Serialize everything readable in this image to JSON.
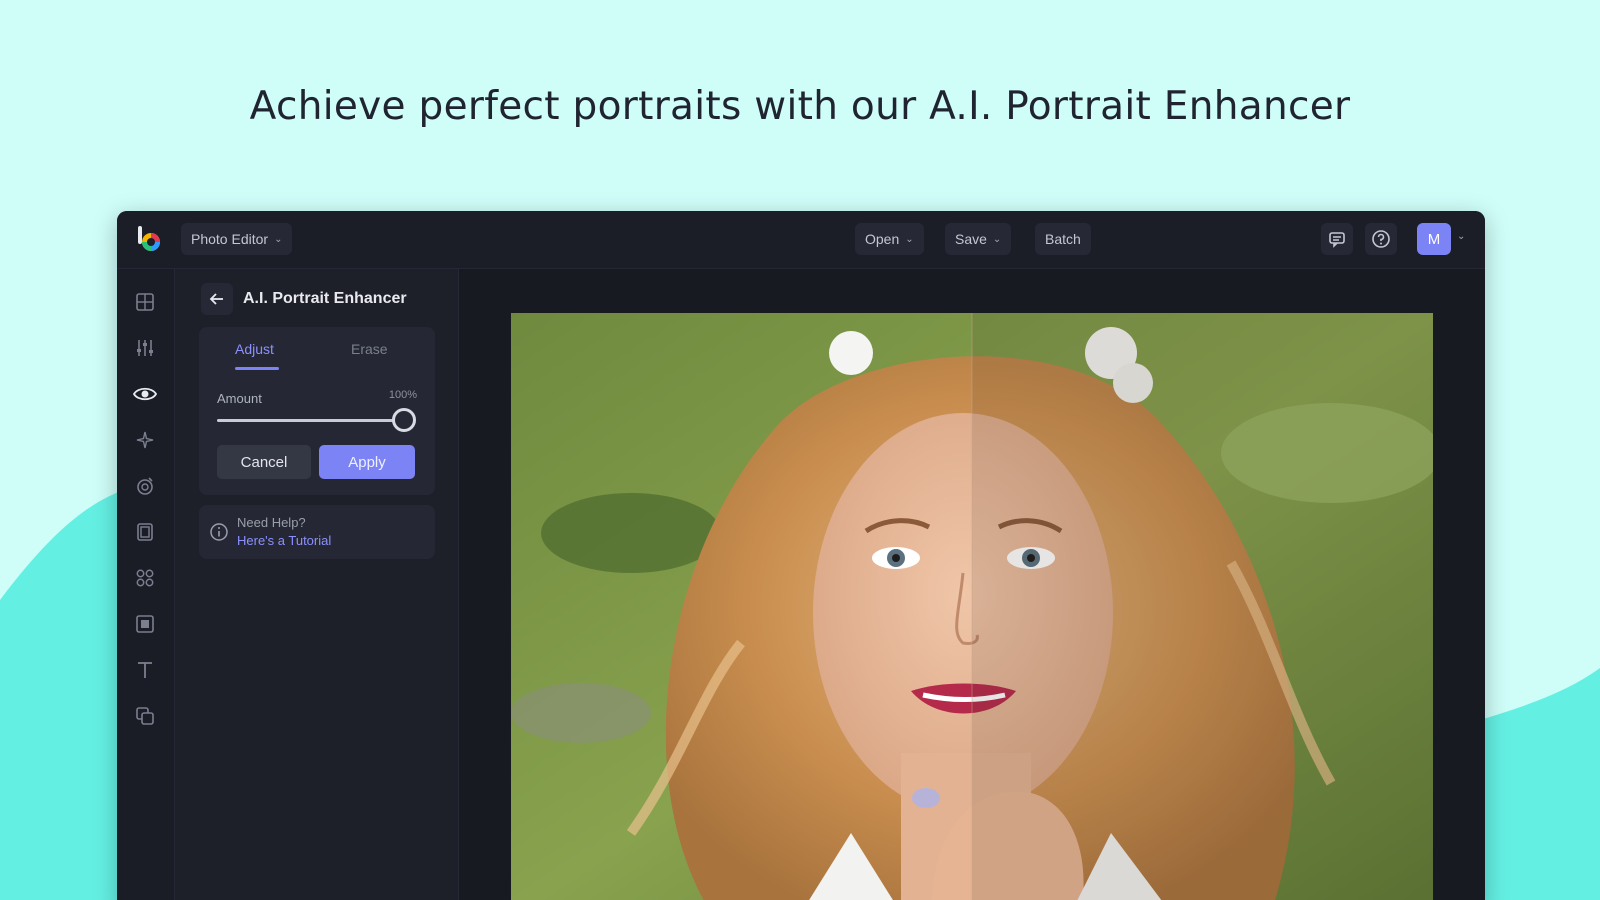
{
  "headline": "Achieve perfect portraits with our A.I. Portrait Enhancer",
  "colors": {
    "background": "#cffdf8",
    "wave": "#64efe3",
    "app_bg": "#181a22",
    "accent": "#7c83f5"
  },
  "topbar": {
    "app_menu_label": "Photo Editor",
    "open_label": "Open",
    "save_label": "Save",
    "batch_label": "Batch",
    "avatar_initial": "M",
    "icons": [
      "logo-icon",
      "feedback-icon",
      "help-icon",
      "chevron-down-icon"
    ]
  },
  "left_rail": {
    "icons": [
      "grid-icon",
      "sliders-icon",
      "eye-icon",
      "sparkle-icon",
      "effects-icon",
      "frame-icon",
      "graphics-icon",
      "overlay-icon",
      "text-icon",
      "layers-icon"
    ],
    "active_index": 2
  },
  "panel": {
    "title": "A.I. Portrait Enhancer",
    "tabs": [
      {
        "label": "Adjust",
        "active": true
      },
      {
        "label": "Erase",
        "active": false
      }
    ],
    "amount_label": "Amount",
    "amount_value": "100%",
    "amount_fraction": 1.0,
    "cancel_label": "Cancel",
    "apply_label": "Apply",
    "help_title": "Need Help?",
    "help_link": "Here's a Tutorial"
  },
  "canvas": {
    "subject": "portrait-photo",
    "comparison_split": "before-after"
  }
}
